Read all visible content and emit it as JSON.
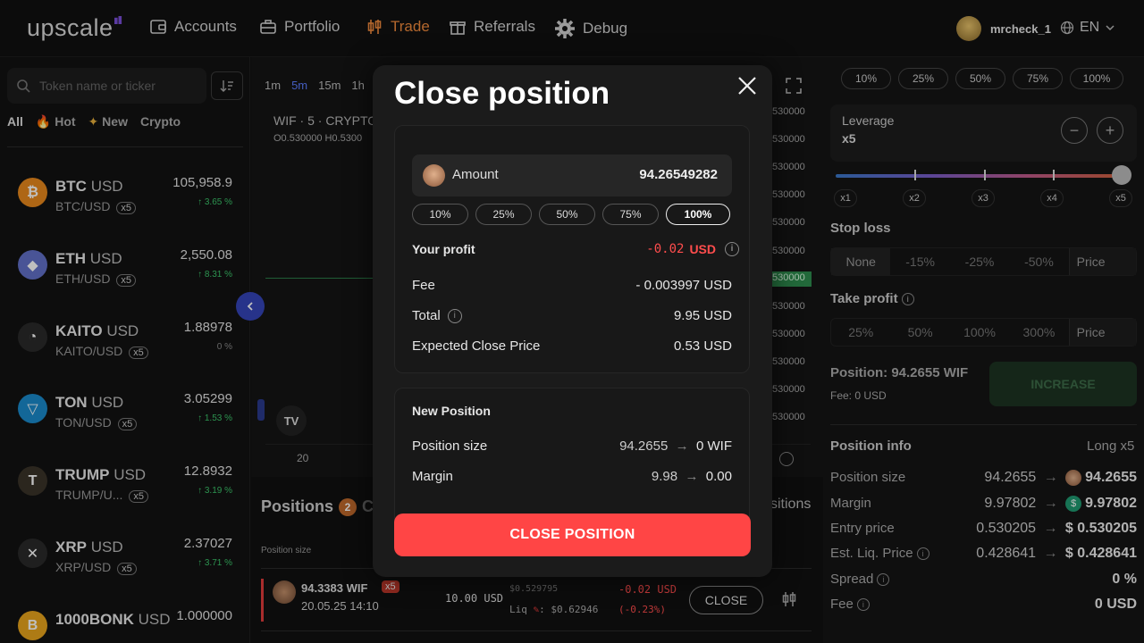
{
  "app": {
    "logo": "upscale"
  },
  "nav": {
    "items": [
      {
        "label": "Accounts",
        "icon": "wallet-icon"
      },
      {
        "label": "Portfolio",
        "icon": "briefcase-icon"
      },
      {
        "label": "Trade",
        "icon": "candles-icon",
        "active": true
      },
      {
        "label": "Referrals",
        "icon": "gift-icon"
      },
      {
        "label": "Debug",
        "icon": "gear-icon"
      }
    ],
    "user": "mrcheck_1",
    "lang": "EN"
  },
  "sidebar": {
    "search_placeholder": "Token name or ticker",
    "filters": [
      "All",
      "Hot",
      "New",
      "Crypto"
    ],
    "tokens": [
      {
        "name": "BTC",
        "quote": "USD",
        "pair": "BTC/USD",
        "lev": "x5",
        "price": "105,958.9",
        "change": "↑ 3.65 %",
        "color": "#e8891c",
        "glyph": "₿"
      },
      {
        "name": "ETH",
        "quote": "USD",
        "pair": "ETH/USD",
        "lev": "x5",
        "price": "2,550.08",
        "change": "↑ 8.31 %",
        "color": "#6270c8",
        "glyph": "◆"
      },
      {
        "name": "KAITO",
        "quote": "USD",
        "pair": "KAITO/USD",
        "lev": "x5",
        "price": "1.88978",
        "change": "0 %",
        "color": "#2a2a2a",
        "glyph": "◔"
      },
      {
        "name": "TON",
        "quote": "USD",
        "pair": "TON/USD",
        "lev": "x5",
        "price": "3.05299",
        "change": "↑ 1.53 %",
        "color": "#1a8acb",
        "glyph": "▽"
      },
      {
        "name": "TRUMP",
        "quote": "USD",
        "pair": "TRUMP/U...",
        "lev": "x5",
        "price": "12.8932",
        "change": "↑ 3.19 %",
        "color": "#3a3328",
        "glyph": "T"
      },
      {
        "name": "XRP",
        "quote": "USD",
        "pair": "XRP/USD",
        "lev": "x5",
        "price": "2.37027",
        "change": "↑ 3.71 %",
        "color": "#2a2a2a",
        "glyph": "✕"
      },
      {
        "name": "1000BONK",
        "quote": "USD",
        "pair": "",
        "lev": "",
        "price": "1.000000",
        "change": "",
        "color": "#e8a41c",
        "glyph": "B"
      }
    ]
  },
  "chart": {
    "timeframes": [
      "1m",
      "5m",
      "15m",
      "1h"
    ],
    "selected_timeframe": "5m",
    "symbol": "WIF · 5 · CRYPTO",
    "ohlc": "O0.530000  H0.5300",
    "price_ticks": [
      "530000",
      "530000",
      "530000",
      "530000",
      "530000",
      "530000",
      "530000",
      "530000",
      "530000",
      "530000",
      "530000",
      "530000"
    ],
    "highlight_tick": "530000",
    "x_tick": "20"
  },
  "positions": {
    "title": "Positions",
    "count": "2",
    "tab_initial": "C",
    "right_label": "sitions",
    "col_header": "Position size",
    "row": {
      "amount": "94.3383 WIF",
      "lev": "x5",
      "date": "20.05.25 14:10",
      "margin": "10.00 USD",
      "entry": "$0.529795",
      "liq_label": "Liq",
      "liq_value": ": $0.62946",
      "pnl": "-0.02  USD",
      "pnl_pct": "(-0.23%)",
      "close_label": "CLOSE"
    }
  },
  "right": {
    "pct_pills": [
      "10%",
      "25%",
      "50%",
      "75%",
      "100%"
    ],
    "leverage_label": "Leverage",
    "leverage_value": "x5",
    "lev_marks": [
      "x1",
      "x2",
      "x3",
      "x4",
      "x5"
    ],
    "stop_loss_label": "Stop loss",
    "stop_loss_opts": [
      "None",
      "-15%",
      "-25%",
      "-50%"
    ],
    "price_placeholder": "Price",
    "take_profit_label": "Take profit",
    "take_profit_opts": [
      "25%",
      "50%",
      "100%",
      "300%"
    ],
    "position_summary": "Position: 94.2655 WIF",
    "fee_summary": "Fee: 0 USD",
    "increase_label": "INCREASE",
    "info_title": "Position info",
    "info_side": "Long x5",
    "info_rows": [
      {
        "label": "Position size",
        "from": "94.2655",
        "to": "94.2655"
      },
      {
        "label": "Margin",
        "from": "9.97802",
        "to": "9.97802"
      },
      {
        "label": "Entry price",
        "from": "0.530205",
        "to": "$ 0.530205"
      },
      {
        "label": "Est. Liq. Price",
        "from": "0.428641",
        "to": "$ 0.428641"
      },
      {
        "label": "Spread",
        "from": "",
        "to": "0 %"
      },
      {
        "label": "Fee",
        "from": "",
        "to": "0 USD"
      }
    ]
  },
  "modal": {
    "title": "Close position",
    "amount_label": "Amount",
    "amount_value": "94.26549282",
    "pct_buttons": [
      "10%",
      "25%",
      "50%",
      "75%",
      "100%"
    ],
    "selected_pct": "100%",
    "profit_label": "Your profit",
    "profit_value": "-0.02",
    "profit_unit": "USD",
    "fee_label": "Fee",
    "fee_value": "- 0.003997 USD",
    "total_label": "Total",
    "total_value": "9.95 USD",
    "ecp_label": "Expected Close Price",
    "ecp_value": "0.53 USD",
    "new_position_title": "New Position",
    "pos_size_label": "Position size",
    "pos_size_from": "94.2655",
    "pos_size_to": "0 WIF",
    "margin_label": "Margin",
    "margin_from": "9.98",
    "margin_to": "0.00",
    "close_button": "CLOSE POSITION"
  }
}
